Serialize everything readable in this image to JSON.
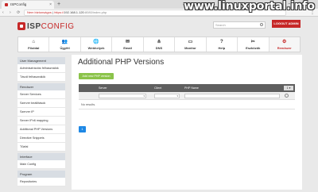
{
  "browser": {
    "tab_title": "ISPConfig",
    "new_tab_symbol": "+",
    "window_controls": "– ▢ ✕",
    "nav_buttons": "‹ › ⟳",
    "url_warning": "Nem biztonságos",
    "url_protocol": "https://",
    "url_host": "192.168.1.120",
    "url_path": ":8080/index.php",
    "menu_symbol": "⋮"
  },
  "watermark": "www.linuxportal.info",
  "header": {
    "logo_isp": "ISP",
    "logo_config": "CONFIG",
    "search_placeholder": "Search",
    "logout_label": "LOGOUT ADMIN"
  },
  "nav": [
    {
      "label": "Főoldal",
      "icon": "home-icon",
      "glyph": "⌂"
    },
    {
      "label": "Ügyfél",
      "icon": "users-icon",
      "glyph": "👥"
    },
    {
      "label": "Webhelyek",
      "icon": "globe-icon",
      "glyph": "🌐"
    },
    {
      "label": "Email",
      "icon": "envelope-icon",
      "glyph": "✉"
    },
    {
      "label": "DNS",
      "icon": "network-icon",
      "glyph": "⋔"
    },
    {
      "label": "Monitor",
      "icon": "monitor-icon",
      "glyph": "▭"
    },
    {
      "label": "Help",
      "icon": "help-icon",
      "glyph": "?"
    },
    {
      "label": "Eszközök",
      "icon": "tools-icon",
      "glyph": "✂"
    },
    {
      "label": "Rendszer",
      "icon": "gear-icon",
      "glyph": "⚙"
    }
  ],
  "sidebar": {
    "sections": [
      {
        "title": "User Management",
        "items": [
          "Adminisztrációs felhasználók",
          "Távoli felhasználók"
        ]
      },
      {
        "title": "Rendszer",
        "items": [
          "Server Services",
          "Szerver beállítások",
          "Szerver IP",
          "Server IPv6 mapping",
          "Additional PHP Versions",
          "Directive Snippets",
          "Tűzfal"
        ]
      },
      {
        "title": "Interface",
        "items": [
          "Main Config"
        ]
      },
      {
        "title": "Program",
        "items": [
          "Repositories"
        ]
      }
    ]
  },
  "main": {
    "title": "Additional PHP Versions",
    "add_button": "Add new PHP version",
    "columns": [
      "Server",
      "Client",
      "PHP Name"
    ],
    "no_results": "No results.",
    "page": "1",
    "header_control": "1 ▾"
  }
}
